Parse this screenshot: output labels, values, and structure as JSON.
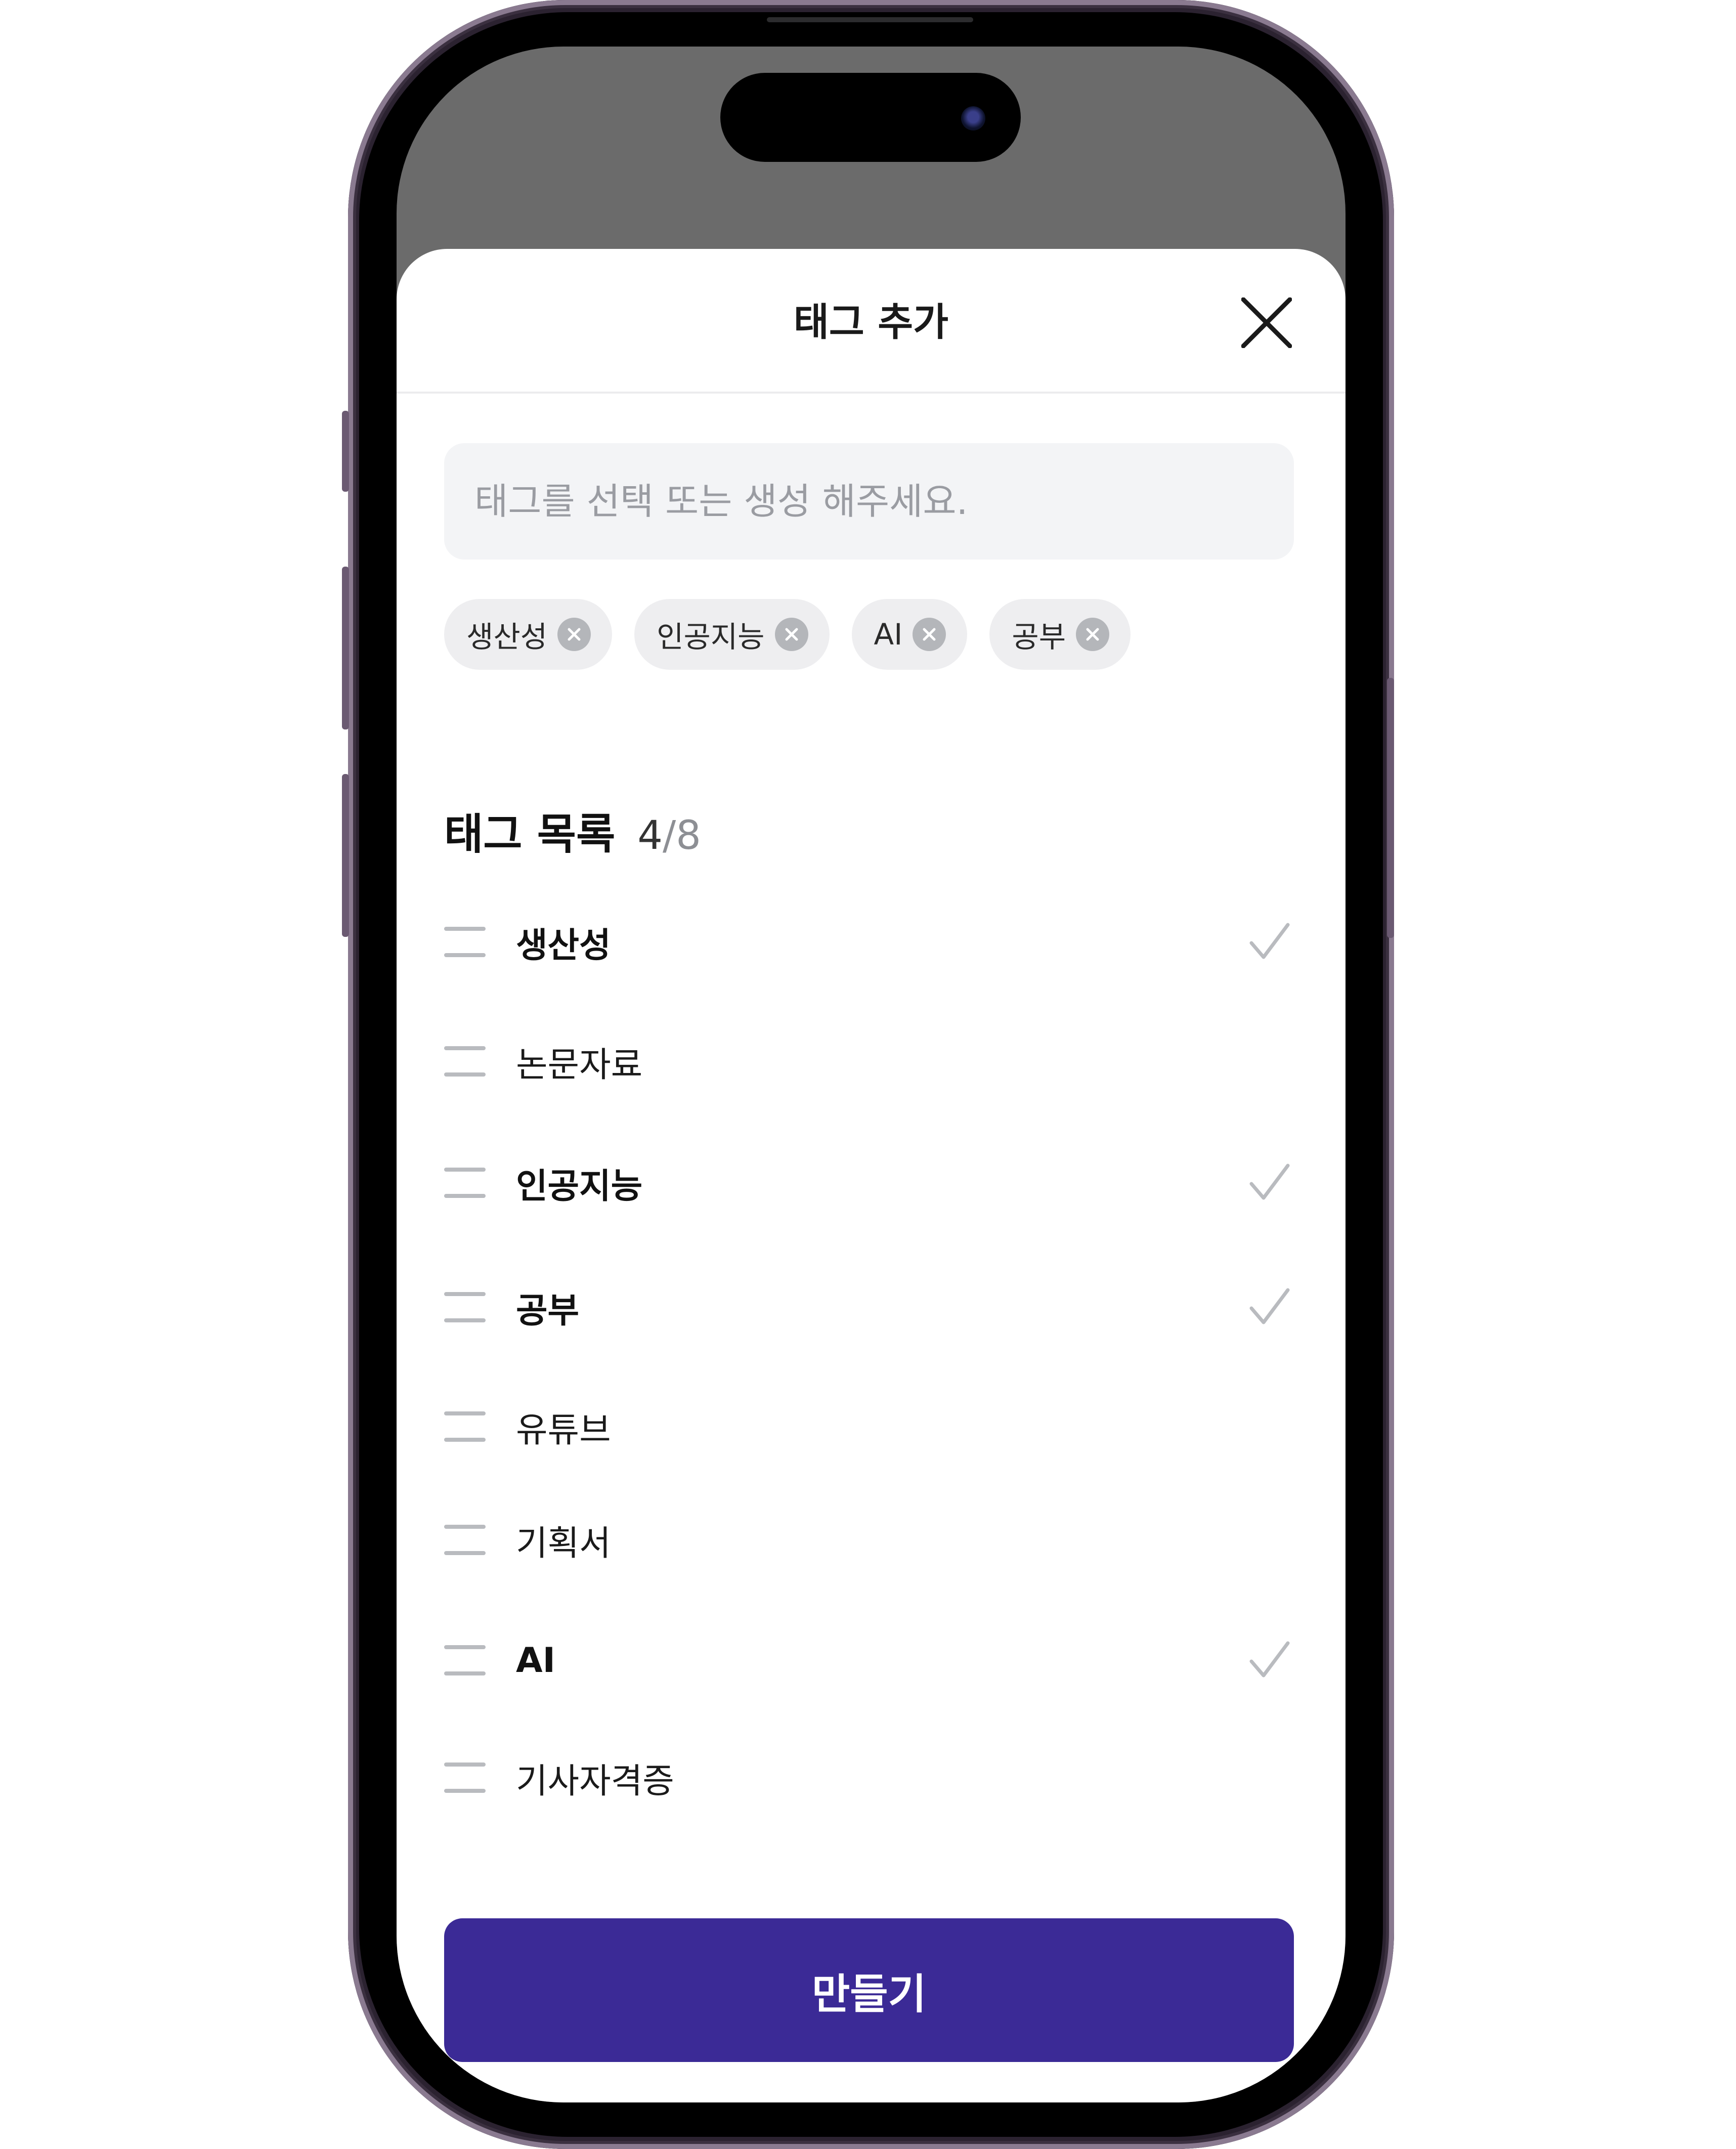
{
  "sheet": {
    "title": "태그 추가"
  },
  "search": {
    "placeholder": "태그를 선택 또는 생성 해주세요."
  },
  "selected_tags": [
    "생산성",
    "인공지능",
    "AI",
    "공부"
  ],
  "tag_list": {
    "heading": "태그 목록",
    "count_selected": "4",
    "count_separator": "/",
    "count_total": "8",
    "items": [
      {
        "label": "생산성",
        "selected": true
      },
      {
        "label": "논문자료",
        "selected": false
      },
      {
        "label": "인공지능",
        "selected": true
      },
      {
        "label": "공부",
        "selected": true
      },
      {
        "label": "유튜브",
        "selected": false
      },
      {
        "label": "기획서",
        "selected": false
      },
      {
        "label": "AI",
        "selected": true
      },
      {
        "label": "기사자격증",
        "selected": false
      }
    ]
  },
  "actions": {
    "create_label": "만들기"
  },
  "colors": {
    "accent": "#3b2a96",
    "overlay": "#6b6b6b",
    "chip_background": "#eeeef0",
    "check": "#b9bbbf"
  },
  "icons": {
    "close": "close-icon",
    "chip_remove": "remove-tag-icon",
    "drag": "drag-handle-icon",
    "check": "checkmark-icon"
  }
}
